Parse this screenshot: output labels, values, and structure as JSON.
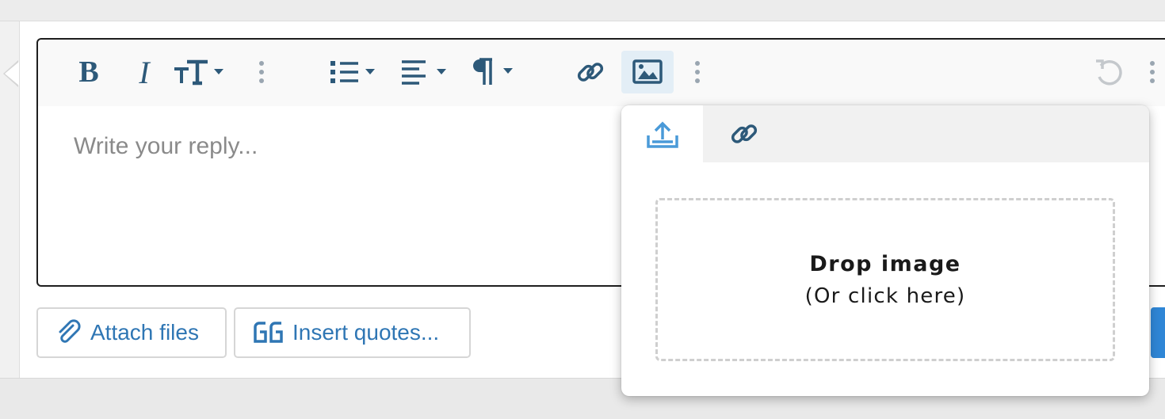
{
  "editor": {
    "placeholder": "Write your reply...",
    "toolbar": {
      "bold_label": "B",
      "italic_label": "I"
    }
  },
  "actions": {
    "attach_label": "Attach files",
    "quotes_label": "Insert quotes..."
  },
  "image_popup": {
    "tabs": [
      {
        "icon": "upload-icon",
        "active": true
      },
      {
        "icon": "link-icon",
        "active": false
      }
    ],
    "drop_title": "Drop image",
    "drop_subtitle": "(Or click here)"
  },
  "colors": {
    "toolbar_icon": "#2d5979",
    "accent_link": "#2f76b4",
    "active_tab_icon": "#4a9ad8",
    "active_button_bg": "#e3eef6"
  }
}
